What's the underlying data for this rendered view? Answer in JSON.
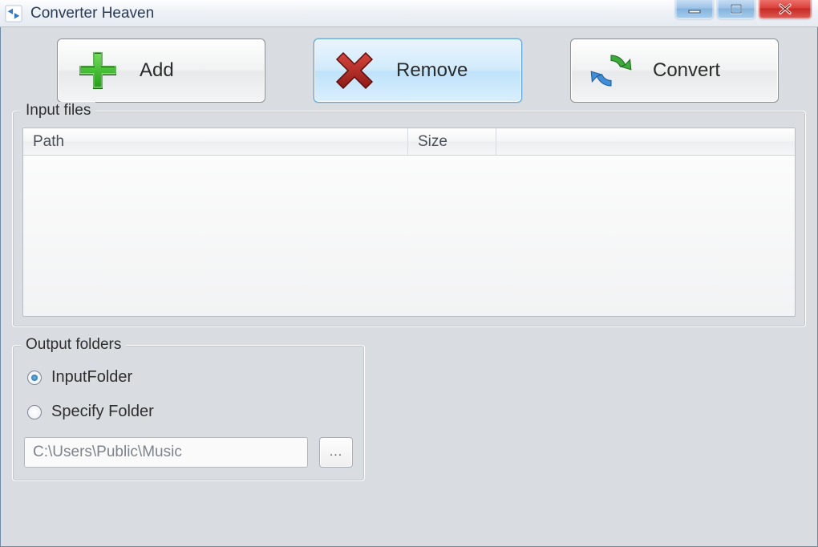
{
  "window": {
    "title": "Converter Heaven"
  },
  "toolbar": {
    "add_label": "Add",
    "remove_label": "Remove",
    "convert_label": "Convert"
  },
  "input_files": {
    "legend": "Input files",
    "columns": {
      "path": "Path",
      "size": "Size"
    },
    "rows": []
  },
  "output": {
    "legend": "Output folders",
    "options": {
      "input_folder": "InputFolder",
      "specify_folder": "Specify Folder"
    },
    "selected": "input_folder",
    "path_value": "C:\\Users\\Public\\Music",
    "browse_label": "..."
  }
}
